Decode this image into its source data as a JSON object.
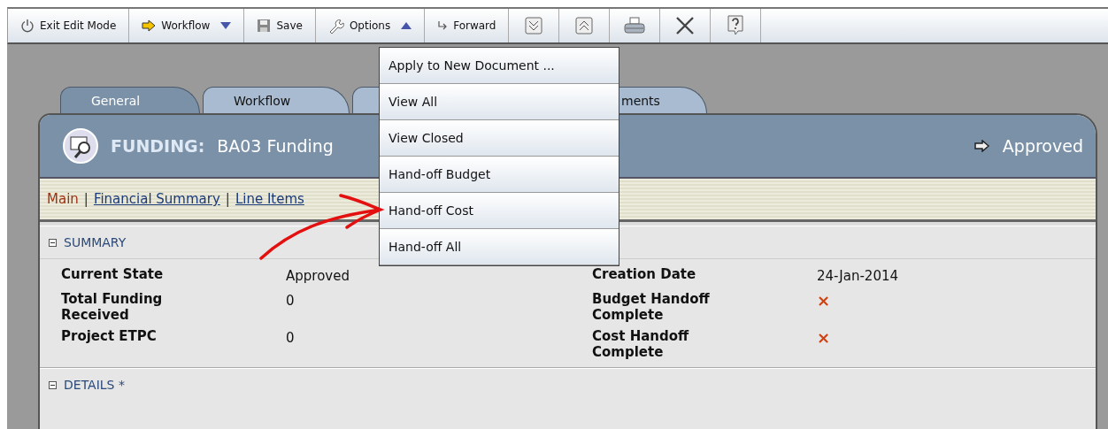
{
  "toolbar": [
    {
      "kind": "text",
      "label": "Exit Edit Mode"
    },
    {
      "kind": "text",
      "label": "Workflow",
      "expanded": false
    },
    {
      "kind": "text",
      "label": "Save"
    },
    {
      "kind": "text",
      "label": "Options",
      "expanded": true
    },
    {
      "kind": "text",
      "label": "Forward"
    },
    {
      "kind": "icon"
    },
    {
      "kind": "icon"
    },
    {
      "kind": "icon"
    },
    {
      "kind": "icon"
    },
    {
      "kind": "icon"
    }
  ],
  "menu": [
    "Apply to New Document ...",
    "View All",
    "View Closed",
    "Hand-off Budget",
    "Hand-off Cost",
    "Hand-off All"
  ],
  "tabs": [
    {
      "label": "General",
      "selected": true
    },
    {
      "label": "Workflow",
      "selected": false
    },
    {
      "selected": false
    },
    {
      "label": "ments",
      "selected": false
    }
  ],
  "header": {
    "type": "FUNDING:",
    "title": "BA03 Funding",
    "status": "Approved"
  },
  "nav": [
    {
      "label": "Main",
      "selected": true
    },
    {
      "separator": "|",
      "label": "Financial Summary",
      "selected": false
    },
    {
      "separator": "|",
      "label": "Line Items",
      "selected": false
    }
  ],
  "summary": {
    "title": "SUMMARY",
    "expanded": true,
    "fields": [
      {
        "label": "Current State",
        "kind": "text",
        "value": "Approved"
      },
      {
        "label": "Creation Date",
        "kind": "text",
        "value": "24-Jan-2014"
      },
      {
        "label": "Total Funding Received",
        "kind": "text",
        "value": "0"
      },
      {
        "label": "Budget Handoff Complete",
        "kind": "cross",
        "value": "×"
      },
      {
        "label": "Project ETPC",
        "kind": "text",
        "value": "0"
      },
      {
        "label": "Cost Handoff Complete",
        "kind": "cross",
        "value": "×"
      }
    ]
  },
  "details": {
    "title": "DETAILS *",
    "expanded": true
  }
}
